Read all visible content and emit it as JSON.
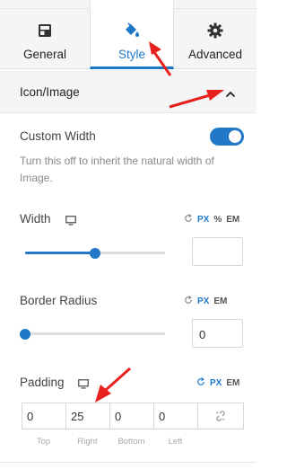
{
  "tabs": [
    {
      "label": "General",
      "icon": "layout-icon"
    },
    {
      "label": "Style",
      "icon": "paint-bucket-icon",
      "active": true
    },
    {
      "label": "Advanced",
      "icon": "gear-icon"
    }
  ],
  "section": {
    "title": "Icon/Image",
    "expanded": true
  },
  "custom_width": {
    "label": "Custom Width",
    "enabled": true,
    "hint": "Turn this off to inherit the natural width of Image."
  },
  "width": {
    "label": "Width",
    "units": [
      "PX",
      "%",
      "EM"
    ],
    "active_unit": "PX",
    "slider_level": 0.5,
    "value": ""
  },
  "border_radius": {
    "label": "Border Radius",
    "units": [
      "PX",
      "EM"
    ],
    "active_unit": "PX",
    "slider_level": 0,
    "value": "0"
  },
  "padding": {
    "label": "Padding",
    "units": [
      "PX",
      "EM"
    ],
    "active_unit": "PX",
    "values": {
      "top": "0",
      "right": "25",
      "bottom": "0",
      "left": "0"
    },
    "side_labels": [
      "Top",
      "Right",
      "Bottom",
      "Left"
    ]
  },
  "colors": {
    "accent": "#2278c7",
    "annotation": "#e8211f"
  }
}
